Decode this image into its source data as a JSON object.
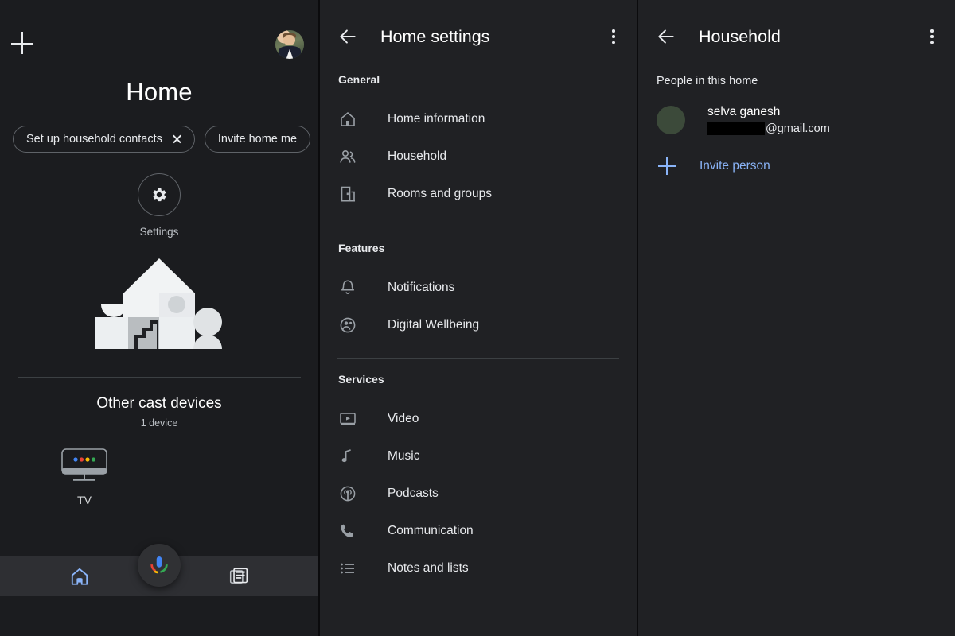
{
  "app": {
    "accent_blue": "#8ab4f8",
    "bg_dark": "#1b1c1f",
    "bg_panel": "#202124"
  },
  "left_panel": {
    "add_icon": "plus-icon",
    "avatar_icon": "account-avatar",
    "title": "Home",
    "chips": [
      {
        "label": "Set up household contacts",
        "dismissible": true
      },
      {
        "label": "Invite home me",
        "dismissible": false
      }
    ],
    "settings": {
      "label": "Settings",
      "icon": "gear-icon"
    },
    "illustration": "home-house-illustration",
    "cast": {
      "title": "Other cast devices",
      "subtitle": "1 device",
      "devices": [
        {
          "name": "TV",
          "icon": "tv-icon"
        }
      ]
    },
    "mic_fab": "google-assistant-mic-icon",
    "bottom_nav": [
      {
        "name": "home",
        "icon": "home-icon",
        "selected": true
      },
      {
        "name": "feed",
        "icon": "feed-icon",
        "selected": false
      }
    ]
  },
  "mid_panel": {
    "back_icon": "back-arrow-icon",
    "title": "Home settings",
    "overflow_icon": "more-vert-icon",
    "sections": [
      {
        "heading": "General",
        "items": [
          {
            "label": "Home information",
            "icon": "house-outline-icon"
          },
          {
            "label": "Household",
            "icon": "people-icon"
          },
          {
            "label": "Rooms and groups",
            "icon": "door-icon"
          }
        ]
      },
      {
        "heading": "Features",
        "items": [
          {
            "label": "Notifications",
            "icon": "bell-icon"
          },
          {
            "label": "Digital Wellbeing",
            "icon": "wellbeing-icon"
          }
        ]
      },
      {
        "heading": "Services",
        "items": [
          {
            "label": "Video",
            "icon": "video-icon"
          },
          {
            "label": "Music",
            "icon": "music-note-icon"
          },
          {
            "label": "Podcasts",
            "icon": "podcast-icon"
          },
          {
            "label": "Communication",
            "icon": "phone-icon"
          },
          {
            "label": "Notes and lists",
            "icon": "list-icon"
          }
        ]
      }
    ]
  },
  "right_panel": {
    "back_icon": "back-arrow-icon",
    "title": "Household",
    "overflow_icon": "more-vert-icon",
    "subheading": "People in this home",
    "people": [
      {
        "name": "selva ganesh",
        "email_suffix": "@gmail.com",
        "email_redacted": true,
        "avatar": "person-avatar"
      }
    ],
    "invite": {
      "label": "Invite person",
      "icon": "plus-icon"
    }
  }
}
